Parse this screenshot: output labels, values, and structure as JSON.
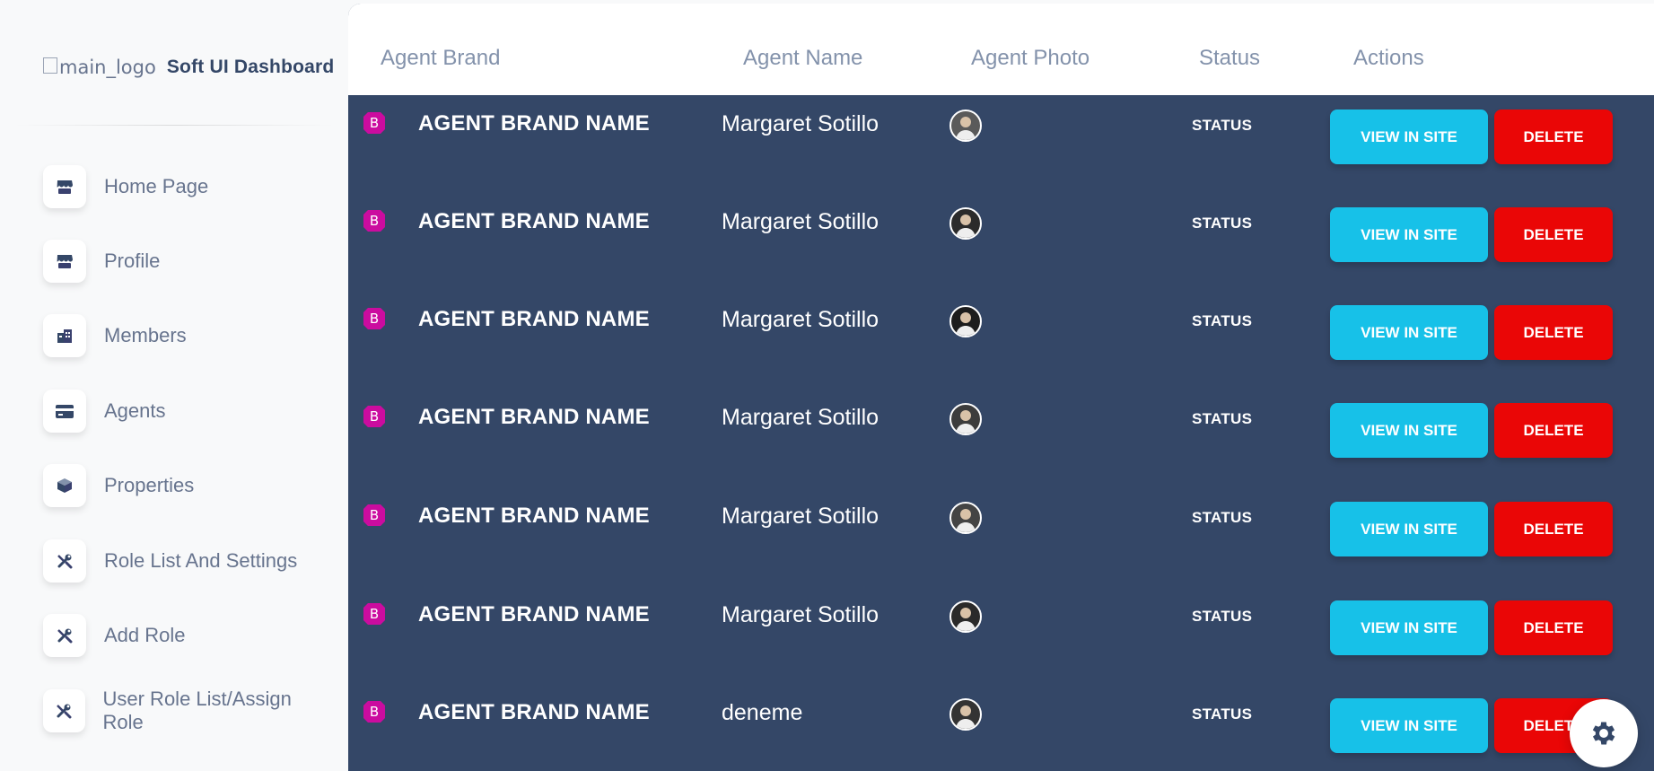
{
  "sidebar": {
    "logo_alt": "main_logo",
    "brand_name": "Soft UI Dashboard",
    "items": [
      {
        "label": "Home Page",
        "icon": "shop-icon"
      },
      {
        "label": "Profile",
        "icon": "shop-icon"
      },
      {
        "label": "Members",
        "icon": "office-icon"
      },
      {
        "label": "Agents",
        "icon": "credit-card-icon"
      },
      {
        "label": "Properties",
        "icon": "box-3d-icon"
      },
      {
        "label": "Role List And Settings",
        "icon": "settings-tools-icon"
      },
      {
        "label": "Add Role",
        "icon": "settings-tools-icon"
      },
      {
        "label": "User Role List/Assign Role",
        "icon": "settings-tools-icon"
      }
    ]
  },
  "table": {
    "headers": [
      "Agent Brand",
      "Agent Name",
      "Agent Photo",
      "Status",
      "Actions"
    ],
    "rows": [
      {
        "brand": "AGENT BRAND NAME",
        "name": "Margaret Sotillo",
        "status": "STATUS"
      },
      {
        "brand": "AGENT BRAND NAME",
        "name": "Margaret Sotillo",
        "status": "STATUS"
      },
      {
        "brand": "AGENT BRAND NAME",
        "name": "Margaret Sotillo",
        "status": "STATUS"
      },
      {
        "brand": "AGENT BRAND NAME",
        "name": "Margaret Sotillo",
        "status": "STATUS"
      },
      {
        "brand": "AGENT BRAND NAME",
        "name": "Margaret Sotillo",
        "status": "STATUS"
      },
      {
        "brand": "AGENT BRAND NAME",
        "name": "Margaret Sotillo",
        "status": "STATUS"
      },
      {
        "brand": "AGENT BRAND NAME",
        "name": "deneme",
        "status": "STATUS"
      }
    ],
    "view_label": "VIEW IN SITE",
    "delete_label": "DELETE"
  },
  "colors": {
    "table_bg": "#344767",
    "view_button": "#17c1e8",
    "delete_button": "#ea0606",
    "brand_icon": "#cb0c9f",
    "sidebar_text": "#67748e"
  },
  "floating": {
    "icon": "gear-icon"
  }
}
